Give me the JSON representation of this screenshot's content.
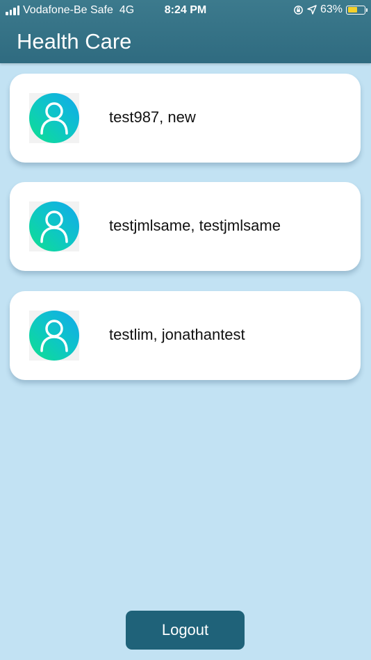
{
  "status_bar": {
    "carrier": "Vodafone-Be Safe",
    "network": "4G",
    "time": "8:24 PM",
    "battery_percent": "63%",
    "battery_level": 0.63,
    "battery_color": "#f5d12a"
  },
  "header": {
    "title": "Health Care",
    "color": "#2f6b80"
  },
  "patients": [
    {
      "name": "test987, new",
      "icon": "user-avatar-icon"
    },
    {
      "name": "testjmlsame, testjmlsame",
      "icon": "user-avatar-icon"
    },
    {
      "name": "testlim, jonathantest",
      "icon": "user-avatar-icon"
    }
  ],
  "logout": {
    "label": "Logout",
    "color": "#1f6279"
  },
  "background_color": "#c2e2f3"
}
